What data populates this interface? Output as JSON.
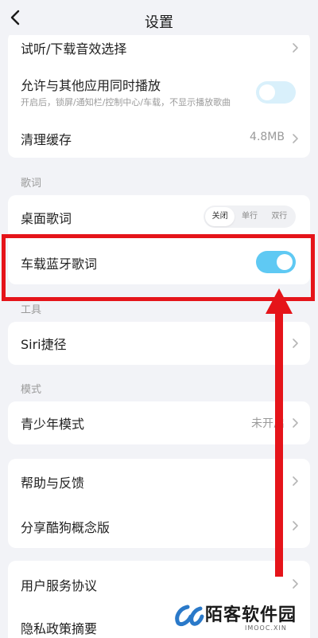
{
  "header": {
    "title": "设置",
    "back_icon": "chevron-left-icon"
  },
  "group1": {
    "sound_effect_label": "试听/下载音效选择",
    "mix_play_label": "允许与其他应用同时播放",
    "mix_play_desc": "开启后，锁屏/通知栏/控制中心/车载，不显示播放歌曲",
    "mix_play_on": false,
    "clear_cache_label": "清理缓存",
    "cache_size": "4.8MB"
  },
  "lyrics": {
    "section_title": "歌词",
    "desktop_lyrics_label": "桌面歌词",
    "desktop_lyrics_options": [
      "关闭",
      "单行",
      "双行"
    ],
    "desktop_lyrics_selected": "关闭",
    "car_bluetooth_label": "车载蓝牙歌词",
    "car_bluetooth_on": true
  },
  "tools": {
    "section_title": "工具",
    "siri_label": "Siri捷径"
  },
  "mode": {
    "section_title": "模式",
    "teen_label": "青少年模式",
    "teen_status": "未开启"
  },
  "help": {
    "feedback_label": "帮助与反馈",
    "share_label": "分享酷狗概念版"
  },
  "legal": {
    "user_agreement_label": "用户服务协议",
    "privacy_label": "隐私政策摘要"
  },
  "watermark": {
    "name": "陌客软件园",
    "domain": "IMOOC.XIN"
  },
  "colors": {
    "toggle_on": "#5fc9f3",
    "toggle_off": "#d9f0fb",
    "highlight": "#e5141a",
    "background": "#f2f3f7"
  }
}
